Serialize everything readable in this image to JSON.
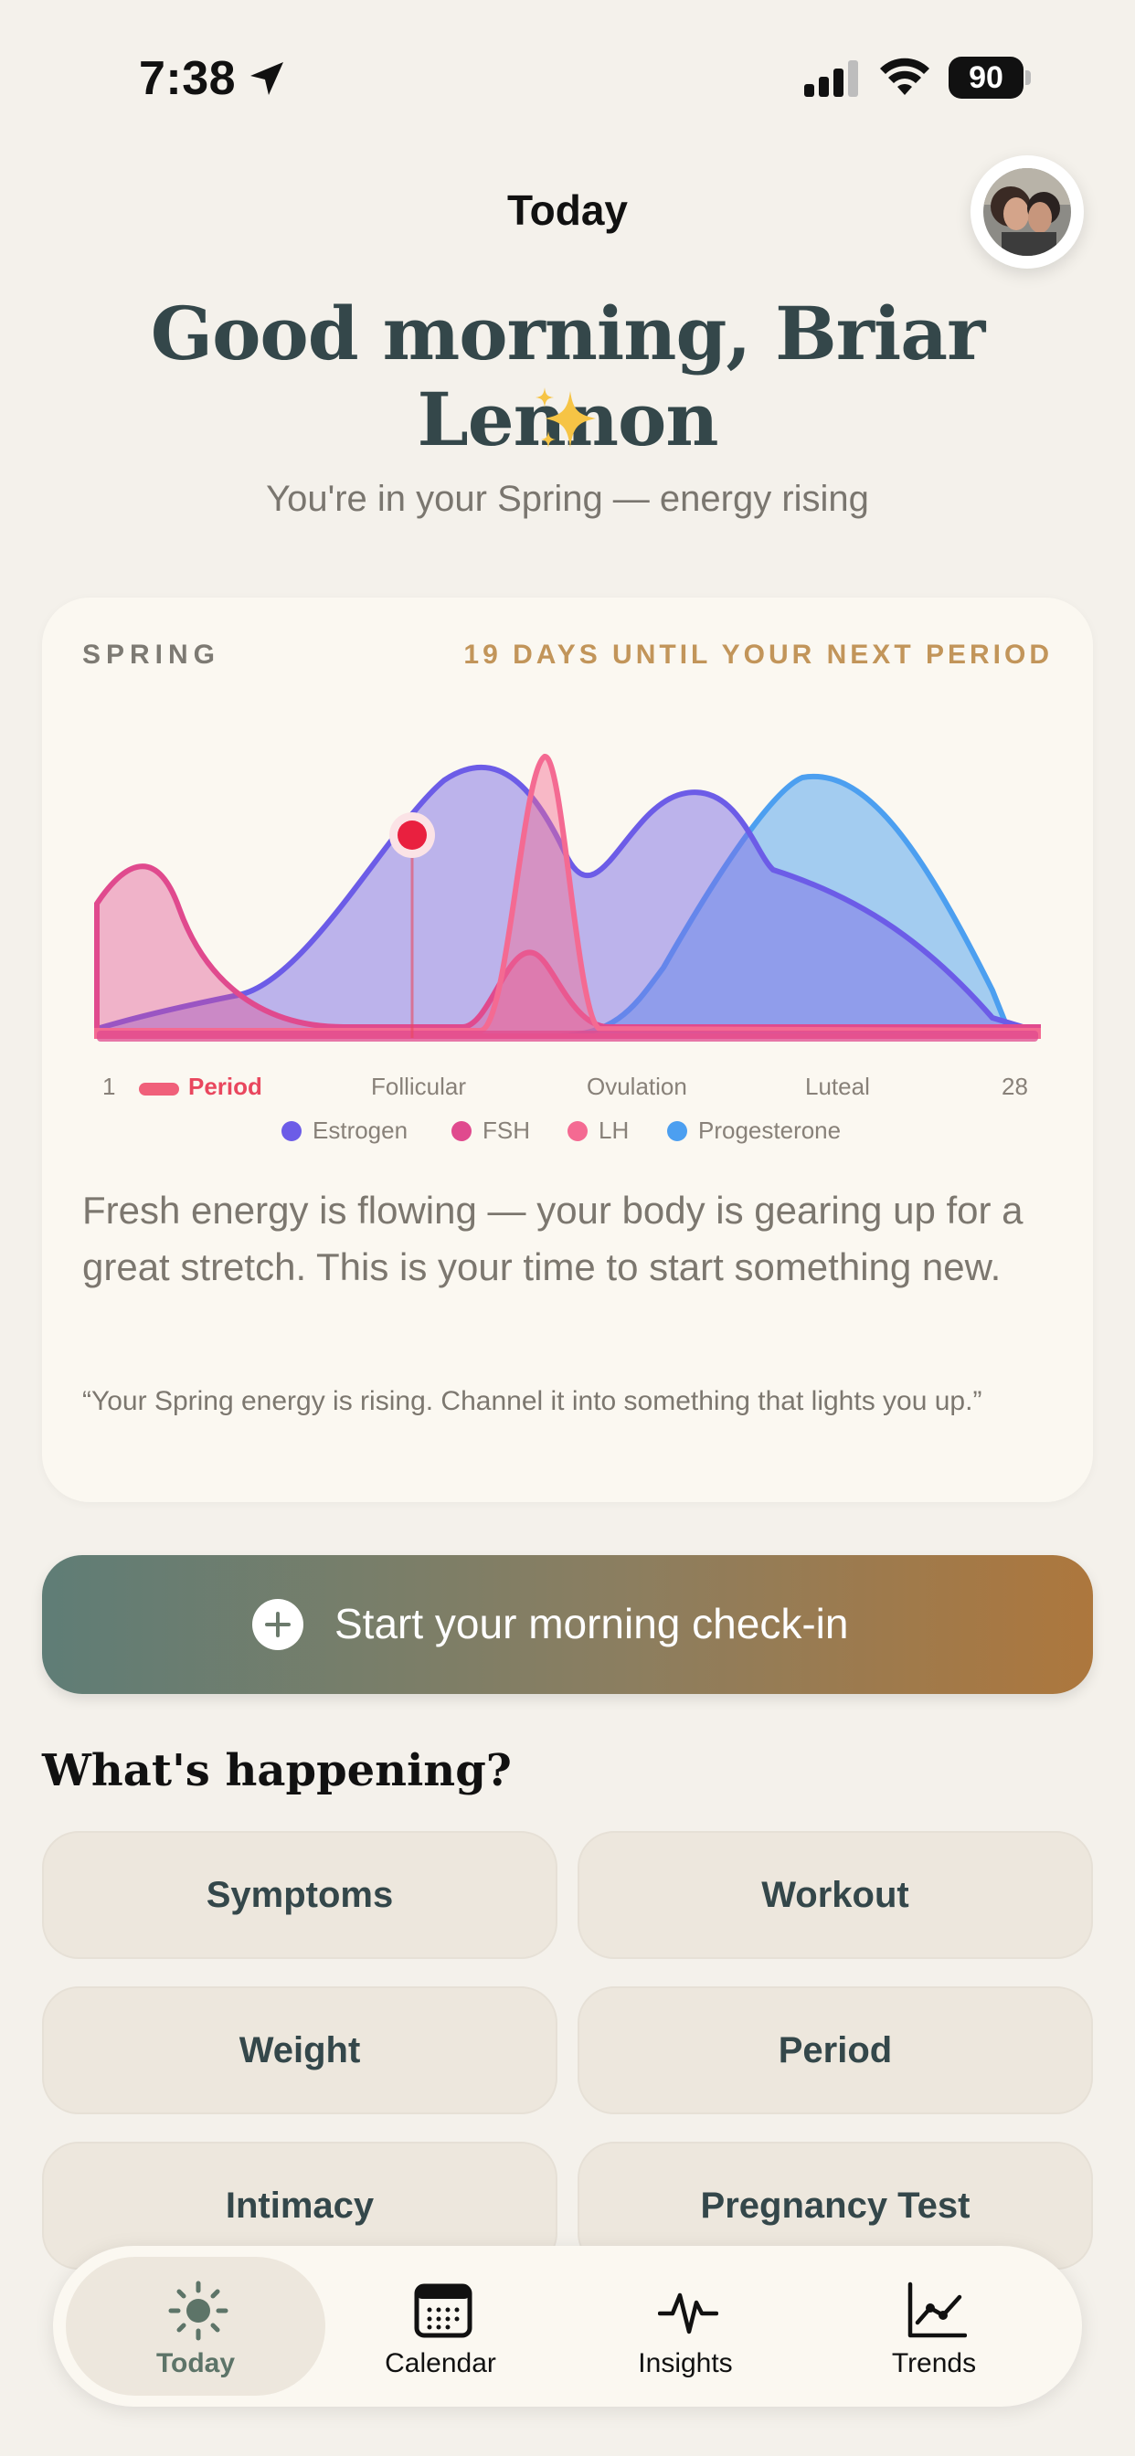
{
  "status_bar": {
    "time": "7:38",
    "battery": "90",
    "icons": [
      "location-arrow-icon",
      "cellular-signal-icon",
      "wifi-icon",
      "battery-icon"
    ]
  },
  "header": {
    "title": "Today",
    "avatar": "profile-avatar"
  },
  "greeting": {
    "text": "Good morning, Briar Lennon",
    "emoji": "sparkles-icon",
    "subtitle": "You're in your Spring — energy rising"
  },
  "cycle_card": {
    "season": "SPRING",
    "countdown": "19 DAYS UNTIL YOUR NEXT PERIOD",
    "axis": {
      "start": "1",
      "period": "Period",
      "follicular": "Follicular",
      "ovulation": "Ovulation",
      "luteal": "Luteal",
      "end": "28"
    },
    "body": "Fresh energy is flowing — your body is gearing up for a great stretch. This is your time to start something new.",
    "quote": "“Your Spring energy is rising. Channel it into something that lights you up.”"
  },
  "chart_data": {
    "type": "area",
    "x_range": [
      1,
      28
    ],
    "x_phase_labels": [
      "1",
      "Period",
      "Follicular",
      "Ovulation",
      "Luteal",
      "28"
    ],
    "current_day_marker": 10,
    "series": [
      {
        "name": "Estrogen",
        "color": "#6C5CE7"
      },
      {
        "name": "FSH",
        "color": "#E04A8E"
      },
      {
        "name": "LH",
        "color": "#F46A92"
      },
      {
        "name": "Progesterone",
        "color": "#4C9FF0"
      }
    ]
  },
  "checkin": {
    "label": "Start your morning check-in"
  },
  "whats_happening": {
    "heading": "What's happening?",
    "buttons": [
      "Symptoms",
      "Workout",
      "Weight",
      "Period",
      "Intimacy",
      "Pregnancy Test"
    ]
  },
  "tab_bar": {
    "tabs": [
      {
        "label": "Today",
        "icon": "sun-icon",
        "active": true
      },
      {
        "label": "Calendar",
        "icon": "calendar-icon",
        "active": false
      },
      {
        "label": "Insights",
        "icon": "pulse-icon",
        "active": false
      },
      {
        "label": "Trends",
        "icon": "trend-chart-icon",
        "active": false
      }
    ]
  },
  "colors": {
    "background": "#F4F1EB",
    "card": "#FBF8F1",
    "accent_gold": "#C2955A",
    "accent_green": "#5D7468",
    "period_red": "#E9475E"
  }
}
